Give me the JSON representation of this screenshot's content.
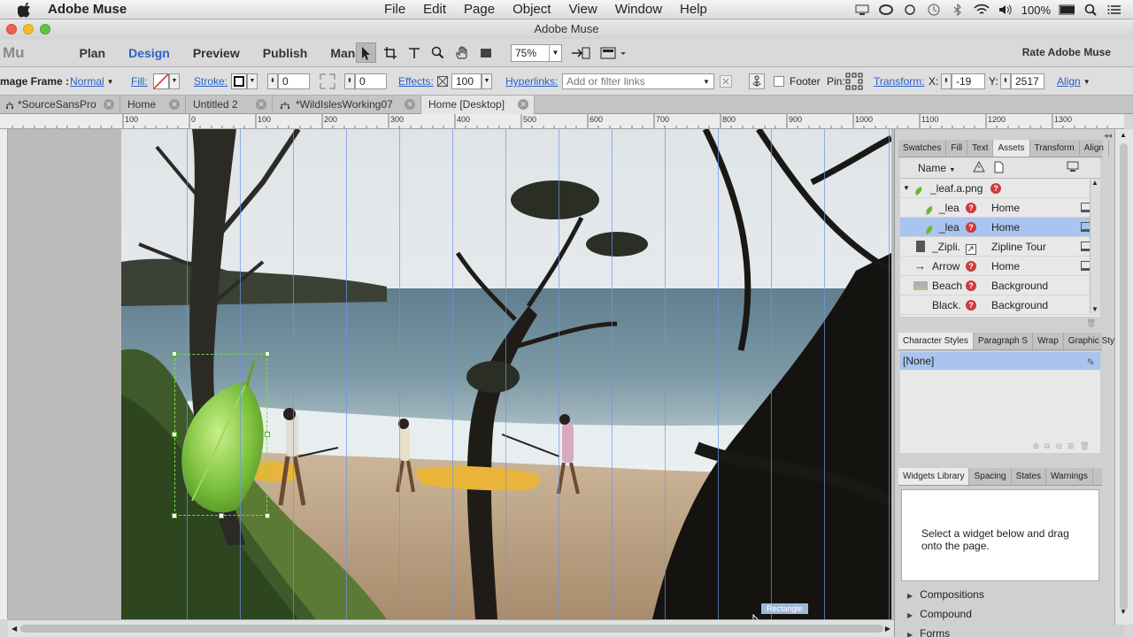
{
  "menubar": {
    "app_name": "Adobe Muse",
    "menus": [
      "File",
      "Edit",
      "Page",
      "Object",
      "View",
      "Window",
      "Help"
    ],
    "battery": "100%"
  },
  "window": {
    "title": "Adobe Muse"
  },
  "modebar": {
    "logo": "Mu",
    "modes": [
      "Plan",
      "Design",
      "Preview",
      "Publish",
      "Manage"
    ],
    "active_mode": "Design",
    "zoom": "75%",
    "rate": "Rate Adobe Muse"
  },
  "controlbar": {
    "frame_label": "mage Frame :",
    "frame_state": "Normal",
    "fill_label": "Fill:",
    "stroke_label": "Stroke:",
    "stroke_value": "0",
    "corner_value": "0",
    "effects_label": "Effects:",
    "effects_value": "100",
    "hyperlinks_label": "Hyperlinks:",
    "hyperlinks_placeholder": "Add or filter links",
    "footer_label": "Footer",
    "pin_label": "Pin:",
    "transform_label": "Transform:",
    "x_label": "X:",
    "x_value": "-19",
    "y_label": "Y:",
    "y_value": "2517",
    "align_label": "Align"
  },
  "doc_tabs": [
    {
      "label": "*SourceSansPro"
    },
    {
      "label": "Home"
    },
    {
      "label": "Untitled 2"
    },
    {
      "label": "*WildIslesWorking07"
    },
    {
      "label": "Home [Desktop]"
    }
  ],
  "ruler": {
    "labels": [
      "100",
      "0",
      "100",
      "200",
      "300",
      "400",
      "500",
      "600",
      "700",
      "800",
      "900",
      "1000",
      "1100",
      "1200",
      "1300"
    ]
  },
  "canvas": {
    "selection_label": "Rectangle"
  },
  "assets_panel": {
    "tabs": [
      "Swatches",
      "Fill",
      "Text",
      "Assets",
      "Transform",
      "Align"
    ],
    "active_tab": "Assets",
    "sort_label": "Name",
    "rows": [
      {
        "name": "_leaf.a.png",
        "page": ""
      },
      {
        "name": "_lea",
        "page": "Home"
      },
      {
        "name": "_lea",
        "page": "Home"
      },
      {
        "name": "_Zipli.",
        "page": "Zipline Tour"
      },
      {
        "name": "Arrow",
        "page": "Home"
      },
      {
        "name": "Beach",
        "page": "Background"
      },
      {
        "name": "Black.",
        "page": "Background"
      }
    ]
  },
  "styles_panel": {
    "tabs": [
      "Character Styles",
      "Paragraph S",
      "Wrap",
      "Graphic Sty"
    ],
    "selected": "[None]"
  },
  "widgets_panel": {
    "tabs": [
      "Widgets Library",
      "Spacing",
      "States",
      "Warnings"
    ],
    "hint": "Select a widget below and drag onto the page.",
    "groups": [
      "Compositions",
      "Compound",
      "Forms"
    ]
  },
  "colors": {
    "accent": "#2a62c9",
    "selected_row": "#a9c4ee",
    "warning": "#d03a3a"
  }
}
